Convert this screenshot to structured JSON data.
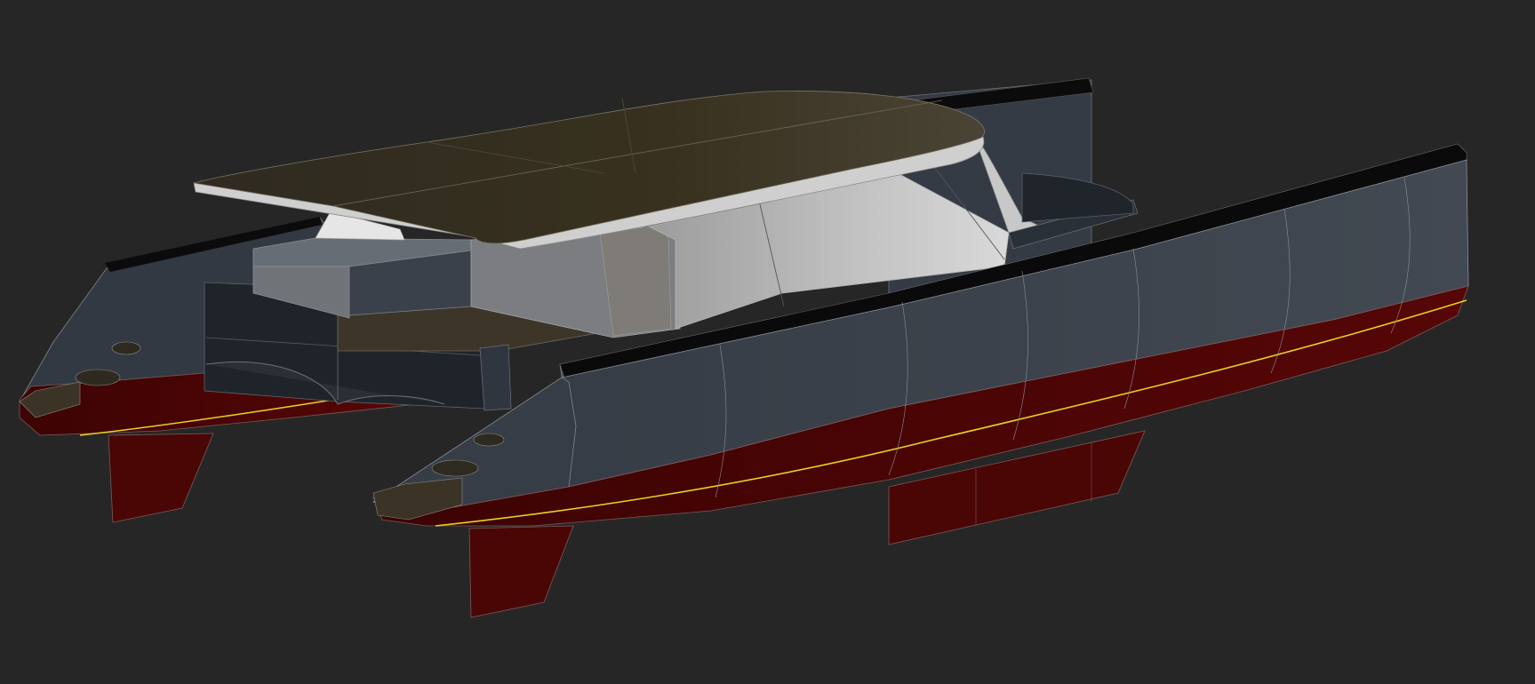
{
  "viewport": {
    "background": "#262626"
  },
  "colors": {
    "hull_topside": "#3a414b",
    "hull_topside_dark": "#2c323a",
    "antifouling": "#4a0505",
    "antifouling_dark": "#3a0404",
    "waterline": "#e8d21e",
    "deck": "#3d3528",
    "deck_dark": "#332c22",
    "hardtop": "#3b3426",
    "hardtop_edge": "#c9c9c9",
    "cabin_glass": "#b8b8b8",
    "cabin_glass_light": "#d2d2d2",
    "sheer_strip": "#0a0a0a",
    "edge_line": "#8a9099"
  }
}
